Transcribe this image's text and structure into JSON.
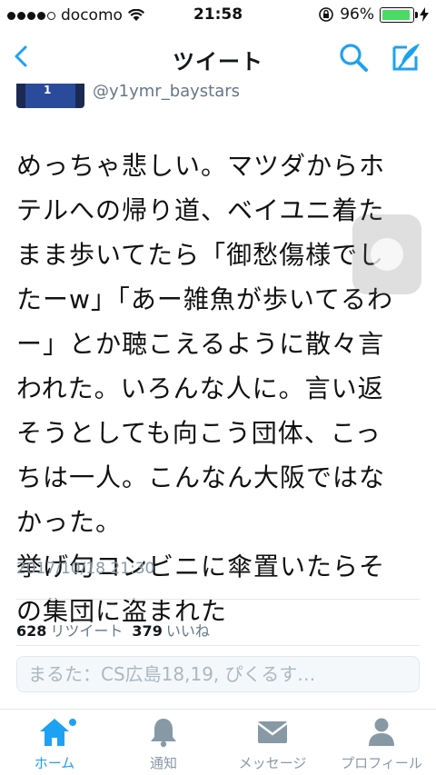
{
  "status_bar": {
    "carrier": "docomo",
    "time": "21:58",
    "battery": "96%"
  },
  "nav": {
    "title": "ツイート"
  },
  "tweet": {
    "handle": "@y1ymr_baystars",
    "lines": [
      "めっちゃ悲しい。マツダからホ",
      "テルへの帰り道、ベイユニ着た",
      "まま歩いてたら「御愁傷様でし",
      "たーw」「あー雑魚が歩いてるわ",
      "ー」とか聴こえるように散々言",
      "われた。いろんな人に。言い返",
      "そうとしても向こう団体、こっ",
      "ちは一人。こんなん大阪ではな",
      "かった。",
      "挙げ句コンビニに傘置いたらそ",
      "の集団に盗まれた"
    ],
    "timestamp": "2017/10/18 21:30",
    "retweet_count": "628",
    "retweet_label": "リツイート",
    "like_count": "379",
    "like_label": "いいね"
  },
  "reply": {
    "placeholder": "まるた：CS広島18,19, ぴくるす…"
  },
  "tabs": [
    {
      "label": "ホーム",
      "icon": "home-icon",
      "active": true
    },
    {
      "label": "通知",
      "icon": "bell-icon"
    },
    {
      "label": "メッセージ",
      "icon": "envelope-icon"
    },
    {
      "label": "プロフィール",
      "icon": "person-icon"
    }
  ],
  "colors": {
    "accent": "#1da1f2",
    "muted": "#8899a6",
    "battery": "#4cd964"
  }
}
